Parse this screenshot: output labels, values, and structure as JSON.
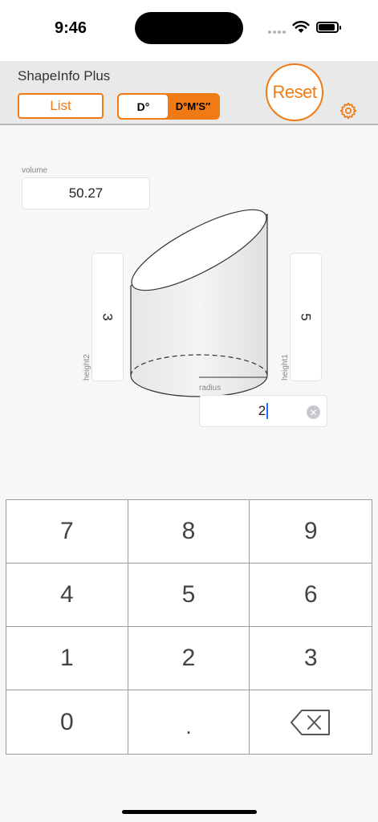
{
  "status": {
    "time": "9:46"
  },
  "header": {
    "title": "ShapeInfo Plus",
    "list_label": "List",
    "mode_options": [
      "D°",
      "D°M′S″"
    ],
    "selected_mode": "D°",
    "reset_label": "Reset",
    "accent_color": "#f07b14"
  },
  "fields": {
    "volume": {
      "label": "volume",
      "value": "50.27"
    },
    "height2": {
      "label": "height2",
      "value": "3"
    },
    "height1": {
      "label": "height1",
      "value": "5"
    },
    "radius": {
      "label": "radius",
      "value": "2"
    }
  },
  "keypad": {
    "keys": [
      "7",
      "8",
      "9",
      "4",
      "5",
      "6",
      "1",
      "2",
      "3",
      "0",
      ".",
      "backspace-icon"
    ]
  }
}
